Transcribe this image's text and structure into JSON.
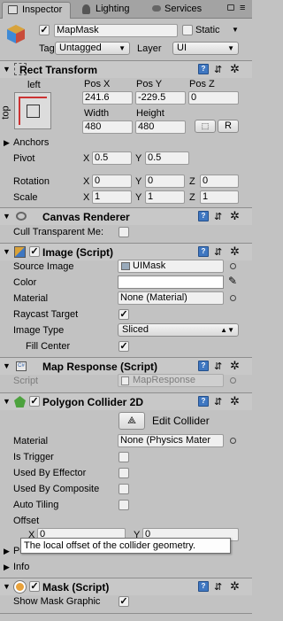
{
  "tabs": [
    {
      "label": "Inspector",
      "icon": "inspector-icon"
    },
    {
      "label": "Lighting",
      "icon": "lighting-icon"
    },
    {
      "label": "Services",
      "icon": "services-icon"
    }
  ],
  "object": {
    "name": "MapMask",
    "static_label": "Static",
    "tag_label": "Tag",
    "tag_value": "Untagged",
    "layer_label": "Layer",
    "layer_value": "UI"
  },
  "rect_transform": {
    "title": "Rect Transform",
    "anchor_h": "left",
    "anchor_v": "top",
    "posx_label": "Pos X",
    "posy_label": "Pos Y",
    "posz_label": "Pos Z",
    "posx": "241.6",
    "posy": "-229.5",
    "posz": "0",
    "width_label": "Width",
    "height_label": "Height",
    "width": "480",
    "height": "480",
    "r_button": "R",
    "anchors_label": "Anchors",
    "pivot_label": "Pivot",
    "pivot_x": "0.5",
    "pivot_y": "0.5",
    "rotation_label": "Rotation",
    "rot_x": "0",
    "rot_y": "0",
    "rot_z": "0",
    "scale_label": "Scale",
    "scale_x": "1",
    "scale_y": "1",
    "scale_z": "1",
    "x": "X",
    "y": "Y",
    "z": "Z"
  },
  "canvas_renderer": {
    "title": "Canvas Renderer",
    "cull_label": "Cull Transparent Me:",
    "cull": false
  },
  "image": {
    "title": "Image (Script)",
    "source_label": "Source Image",
    "source_value": "UIMask",
    "color_label": "Color",
    "color": "#ffffff",
    "material_label": "Material",
    "material_value": "None (Material)",
    "raycast_label": "Raycast Target",
    "raycast": true,
    "type_label": "Image Type",
    "type_value": "Sliced",
    "fill_label": "Fill Center",
    "fill": true
  },
  "map_response": {
    "title": "Map Response (Script)",
    "script_label": "Script",
    "script_value": "MapResponse"
  },
  "polygon": {
    "title": "Polygon Collider 2D",
    "edit_label": "Edit Collider",
    "material_label": "Material",
    "material_value": "None (Physics Mater",
    "trigger_label": "Is Trigger",
    "effector_label": "Used By Effector",
    "composite_label": "Used By Composite",
    "tiling_label": "Auto Tiling",
    "offset_label": "Offset",
    "offset_x": "0",
    "offset_y": "0",
    "points_label": "Points",
    "info_label": "Info",
    "tooltip": "The local offset of the collider geometry."
  },
  "mask": {
    "title": "Mask (Script)",
    "show_label": "Show Mask Graphic",
    "show": true
  },
  "colors": {
    "panel": "#c2c2c2",
    "header": "#c8c8c8",
    "accent_blue": "#3f77c1"
  }
}
